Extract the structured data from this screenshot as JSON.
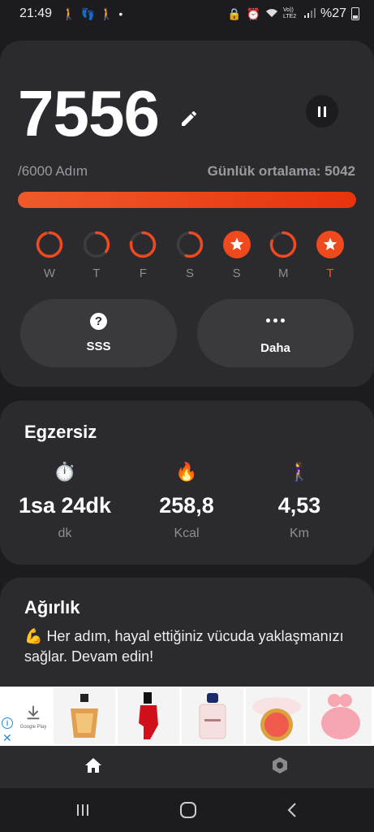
{
  "status_bar": {
    "time": "21:49",
    "battery": "%27",
    "left_icons": [
      "walk-icon",
      "footprints-icon",
      "walk-icon",
      "dot-icon"
    ],
    "right_icons": [
      "lock-icon",
      "alarm-icon",
      "wifi-icon",
      "volte-icon",
      "signal-icon",
      "battery-icon"
    ],
    "network": "Vo)) LTE2"
  },
  "steps": {
    "count": "7556",
    "goal": "/6000 Adım",
    "average": "Günlük ortalama: 5042",
    "progress": 1.0,
    "accent_color": "#ee4a1e"
  },
  "week": [
    {
      "label": "W",
      "progress": 0.95,
      "goal_met": false,
      "today": false
    },
    {
      "label": "T",
      "progress": 0.35,
      "goal_met": false,
      "today": false
    },
    {
      "label": "F",
      "progress": 0.78,
      "goal_met": false,
      "today": false
    },
    {
      "label": "S",
      "progress": 0.55,
      "goal_met": false,
      "today": false
    },
    {
      "label": "S",
      "progress": 1.0,
      "goal_met": true,
      "today": false
    },
    {
      "label": "M",
      "progress": 0.8,
      "goal_met": false,
      "today": false
    },
    {
      "label": "T",
      "progress": 1.0,
      "goal_met": true,
      "today": true
    }
  ],
  "actions": {
    "faq_label": "SSS",
    "more_label": "Daha"
  },
  "exercise": {
    "title": "Egzersiz",
    "stats": [
      {
        "icon": "⏱️",
        "value": "1sa 24dk",
        "unit": "dk"
      },
      {
        "icon": "🔥",
        "value": "258,8",
        "unit": "Kcal"
      },
      {
        "icon": "🚶‍♀️",
        "value": "4,53",
        "unit": "Km"
      }
    ]
  },
  "weight": {
    "title": "Ağırlık",
    "emoji": "💪",
    "message": "Her adım, hayal ettiğiniz vücuda yaklaşmanızı sağlar. Devam edin!"
  },
  "ad": {
    "store_text": "Google Play",
    "info_symbol": "i",
    "close_symbol": "✕",
    "products": [
      "perfume-bottle-1",
      "red-heel-bottle",
      "my-way-bottle",
      "blush-compact",
      "pink-perfume"
    ]
  },
  "bottom_nav": {
    "items": [
      "home-icon",
      "settings-icon"
    ]
  }
}
